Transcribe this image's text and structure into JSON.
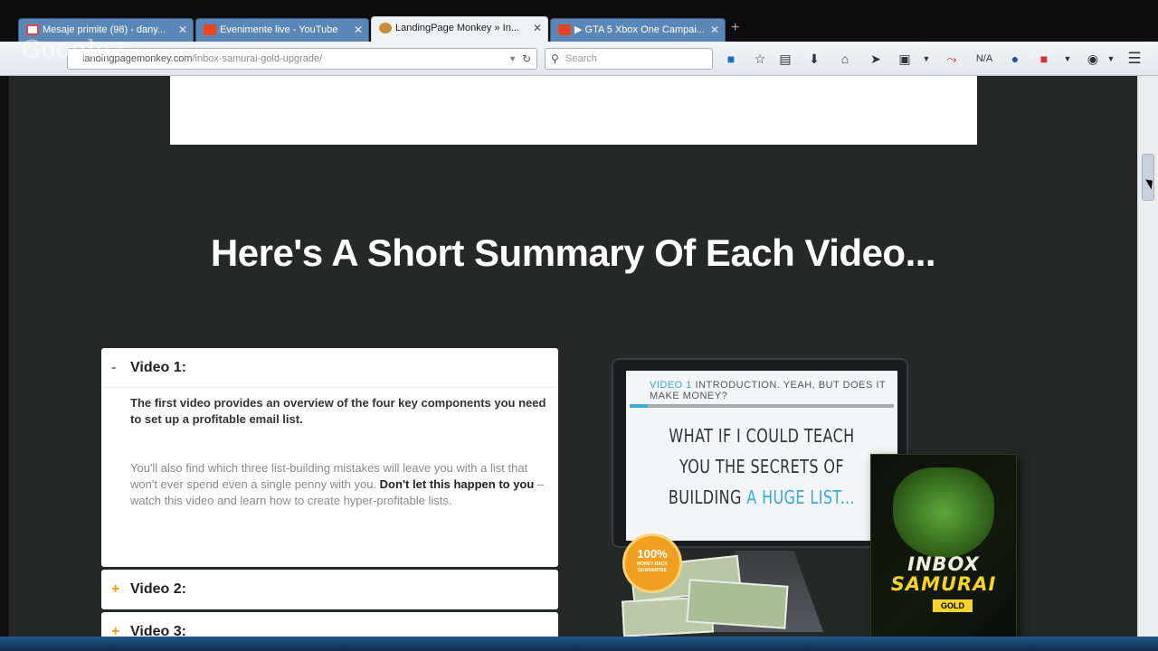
{
  "browser": {
    "tabs": [
      {
        "label": "Mesaje primite (98) - dany...",
        "favicon": "gmail-icon"
      },
      {
        "label": "Evenimente live - YouTube",
        "favicon": "youtube-icon"
      },
      {
        "label": "LandingPage Monkey » In...",
        "favicon": "monkey-icon",
        "active": true
      },
      {
        "label": "▶ GTA 5 Xbox One Campai...",
        "favicon": "youtube-icon"
      }
    ],
    "new_tab_label": "+",
    "url_domain": "lanoingpagemonkey.com",
    "url_path": "/inbox-samurai-gold-upgrade/",
    "search_placeholder": "Search",
    "toolbar_text": "N/A",
    "watermark": "Google+"
  },
  "page": {
    "heading": "Here's A Short Summary Of Each Video...",
    "accordion": [
      {
        "title": "Video 1:",
        "sign": "-",
        "expanded": true,
        "p1": "The first video provides an overview of the four key components you need to set up a profitable email list.",
        "p2_a": "You'll also find which three list-building mistakes will leave you with a list that won't ever spend even a single penny with you.",
        "p2_bold": "Don't let this happen to you",
        "p2_b": " – watch this video and learn how to create hyper-profitable lists."
      },
      {
        "title": "Video 2:",
        "sign": "+",
        "expanded": false
      },
      {
        "title": "Video 3:",
        "sign": "+",
        "expanded": false
      }
    ],
    "product": {
      "screen_label": "VIDEO 1",
      "screen_topic": "INTRODUCTION. YEAH, BUT DOES IT MAKE MONEY?",
      "screen_line1": "WHAT IF I COULD TEACH",
      "screen_line2": "YOU THE SECRETS OF",
      "screen_line3_a": "BUILDING",
      "screen_line3_b": "A HUGE LIST...",
      "badge_big": "100%",
      "badge_small": "MONEY BACK GUARANTEE",
      "box_title_1": "INBOX",
      "box_title_2": "SAMURAI",
      "box_gold": "GOLD"
    }
  },
  "colors": {
    "page_bg": "#262727",
    "accent": "#f39c12",
    "screen_accent": "#3aa8d8"
  }
}
